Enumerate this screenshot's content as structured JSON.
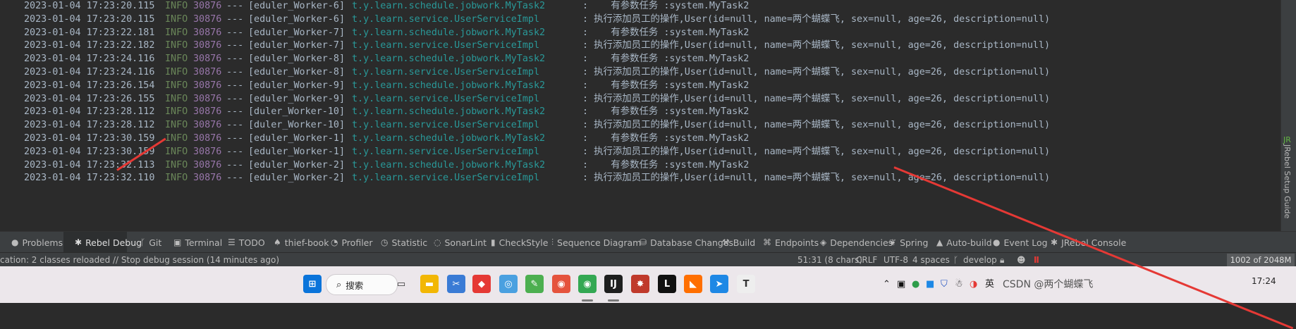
{
  "console": {
    "rows": [
      {
        "ts": "2023-01-04 17:23:20.115",
        "level": "INFO",
        "pid": "30876",
        "sep": "---",
        "thread": "[eduler_Worker-6]",
        "cls": "t.y.learn.schedule.jobwork.MyTask2",
        "msg": ":    有参数任务 :system.MyTask2"
      },
      {
        "ts": "2023-01-04 17:23:20.115",
        "level": "INFO",
        "pid": "30876",
        "sep": "---",
        "thread": "[eduler_Worker-6]",
        "cls": "t.y.learn.service.UserServiceImpl",
        "msg": ": 执行添加员工的操作,User(id=null, name=两个蝴蝶飞, sex=null, age=26, description=null)"
      },
      {
        "ts": "2023-01-04 17:23:22.181",
        "level": "INFO",
        "pid": "30876",
        "sep": "---",
        "thread": "[eduler_Worker-7]",
        "cls": "t.y.learn.schedule.jobwork.MyTask2",
        "msg": ":    有参数任务 :system.MyTask2"
      },
      {
        "ts": "2023-01-04 17:23:22.182",
        "level": "INFO",
        "pid": "30876",
        "sep": "---",
        "thread": "[eduler_Worker-7]",
        "cls": "t.y.learn.service.UserServiceImpl",
        "msg": ": 执行添加员工的操作,User(id=null, name=两个蝴蝶飞, sex=null, age=26, description=null)"
      },
      {
        "ts": "2023-01-04 17:23:24.116",
        "level": "INFO",
        "pid": "30876",
        "sep": "---",
        "thread": "[eduler_Worker-8]",
        "cls": "t.y.learn.schedule.jobwork.MyTask2",
        "msg": ":    有参数任务 :system.MyTask2"
      },
      {
        "ts": "2023-01-04 17:23:24.116",
        "level": "INFO",
        "pid": "30876",
        "sep": "---",
        "thread": "[eduler_Worker-8]",
        "cls": "t.y.learn.service.UserServiceImpl",
        "msg": ": 执行添加员工的操作,User(id=null, name=两个蝴蝶飞, sex=null, age=26, description=null)"
      },
      {
        "ts": "2023-01-04 17:23:26.154",
        "level": "INFO",
        "pid": "30876",
        "sep": "---",
        "thread": "[eduler_Worker-9]",
        "cls": "t.y.learn.schedule.jobwork.MyTask2",
        "msg": ":    有参数任务 :system.MyTask2"
      },
      {
        "ts": "2023-01-04 17:23:26.155",
        "level": "INFO",
        "pid": "30876",
        "sep": "---",
        "thread": "[eduler_Worker-9]",
        "cls": "t.y.learn.service.UserServiceImpl",
        "msg": ": 执行添加员工的操作,User(id=null, name=两个蝴蝶飞, sex=null, age=26, description=null)"
      },
      {
        "ts": "2023-01-04 17:23:28.112",
        "level": "INFO",
        "pid": "30876",
        "sep": "---",
        "thread": "[duler_Worker-10]",
        "cls": "t.y.learn.schedule.jobwork.MyTask2",
        "msg": ":    有参数任务 :system.MyTask2"
      },
      {
        "ts": "2023-01-04 17:23:28.112",
        "level": "INFO",
        "pid": "30876",
        "sep": "---",
        "thread": "[duler_Worker-10]",
        "cls": "t.y.learn.service.UserServiceImpl",
        "msg": ": 执行添加员工的操作,User(id=null, name=两个蝴蝶飞, sex=null, age=26, description=null)"
      },
      {
        "ts": "2023-01-04 17:23:30.159",
        "level": "INFO",
        "pid": "30876",
        "sep": "---",
        "thread": "[eduler_Worker-1]",
        "cls": "t.y.learn.schedule.jobwork.MyTask2",
        "msg": ":    有参数任务 :system.MyTask2"
      },
      {
        "ts": "2023-01-04 17:23:30.159",
        "level": "INFO",
        "pid": "30876",
        "sep": "---",
        "thread": "[eduler_Worker-1]",
        "cls": "t.y.learn.service.UserServiceImpl",
        "msg": ": 执行添加员工的操作,User(id=null, name=两个蝴蝶飞, sex=null, age=26, description=null)"
      },
      {
        "ts": "2023-01-04 17:23:32.113",
        "level": "INFO",
        "pid": "30876",
        "sep": "---",
        "thread": "[eduler_Worker-2]",
        "cls": "t.y.learn.schedule.jobwork.MyTask2",
        "msg": ":    有参数任务 :system.MyTask2"
      },
      {
        "ts": "2023-01-04 17:23:32.110",
        "level": "INFO",
        "pid": "30876",
        "sep": "---",
        "thread": "[eduler_Worker-2]",
        "cls": "t.y.learn.service.UserServiceImpl",
        "msg": ": 执行添加员工的操作,User(id=null, name=两个蝴蝶飞, sex=null, age=26, description=null)"
      }
    ]
  },
  "right_panel": {
    "label": "JRebel Setup Guide",
    "badge": "JR"
  },
  "toolbar": {
    "tabs": [
      {
        "label": "Problems",
        "icon": "problems-icon",
        "glyph": "●"
      },
      {
        "label": "Rebel Debug",
        "icon": "rebel-debug-icon",
        "glyph": "✱"
      },
      {
        "label": "Git",
        "icon": "git-icon",
        "glyph": "ᚴ"
      },
      {
        "label": "Terminal",
        "icon": "terminal-icon",
        "glyph": "▣"
      },
      {
        "label": "TODO",
        "icon": "todo-icon",
        "glyph": "☰"
      },
      {
        "label": "thief-book",
        "icon": "thief-book-icon",
        "glyph": "♠"
      },
      {
        "label": "Profiler",
        "icon": "profiler-icon",
        "glyph": "◔"
      },
      {
        "label": "Statistic",
        "icon": "statistic-icon",
        "glyph": "◷"
      },
      {
        "label": "SonarLint",
        "icon": "sonarlint-icon",
        "glyph": "◌"
      },
      {
        "label": "CheckStyle",
        "icon": "checkstyle-icon",
        "glyph": "▮"
      },
      {
        "label": "Sequence Diagram",
        "icon": "sequence-diagram-icon",
        "glyph": "⫶"
      },
      {
        "label": "Database Changes",
        "icon": "database-icon",
        "glyph": "⛁"
      },
      {
        "label": "Build",
        "icon": "build-icon",
        "glyph": "⚒"
      },
      {
        "label": "Endpoints",
        "icon": "endpoints-icon",
        "glyph": "⌘"
      },
      {
        "label": "Dependencies",
        "icon": "dependencies-icon",
        "glyph": "◈"
      },
      {
        "label": "Spring",
        "icon": "spring-icon",
        "glyph": "❦"
      },
      {
        "label": "Auto-build",
        "icon": "auto-build-icon",
        "glyph": "▲"
      },
      {
        "label": "Event Log",
        "icon": "event-log-icon",
        "glyph": "●"
      },
      {
        "label": "JRebel Console",
        "icon": "jrebel-console-icon",
        "glyph": "✱"
      }
    ],
    "active": "Rebel Debug"
  },
  "status": {
    "message": "cation: 2 classes reloaded // Stop debug session (14 minutes ago)",
    "position": "51:31 (8 chars)",
    "line_sep": "CRLF",
    "encoding": "UTF-8",
    "indent": "4 spaces",
    "branch": "develop",
    "memory": "1002 of 2048M"
  },
  "taskbar": {
    "search_label": "搜索",
    "apps": [
      {
        "name": "start-icon",
        "glyph": "⊞",
        "color": "#0a74da"
      },
      {
        "name": "task-view-icon",
        "glyph": "▭",
        "color": "#333333"
      },
      {
        "name": "file-explorer-icon",
        "glyph": "▬",
        "color": "#f2b705"
      },
      {
        "name": "snipping-icon",
        "glyph": "✂",
        "color": "#3a7bd5"
      },
      {
        "name": "app-red-icon",
        "glyph": "◆",
        "color": "#e53935"
      },
      {
        "name": "app-circles-icon",
        "glyph": "◎",
        "color": "#4aa0e0"
      },
      {
        "name": "notepad-icon",
        "glyph": "✎",
        "color": "#4caf50"
      },
      {
        "name": "app-spiral-icon",
        "glyph": "◉",
        "color": "#e5533d"
      },
      {
        "name": "chrome-icon",
        "glyph": "◉",
        "color": "#34a853"
      },
      {
        "name": "intellij-icon",
        "glyph": "IJ",
        "color": "#1e1e1e"
      },
      {
        "name": "app-star-icon",
        "glyph": "✸",
        "color": "#c0392b"
      },
      {
        "name": "app-l-icon",
        "glyph": "L",
        "color": "#111111"
      },
      {
        "name": "app-orange-icon",
        "glyph": "◣",
        "color": "#ff6f00"
      },
      {
        "name": "app-blue-icon",
        "glyph": "➤",
        "color": "#1e88e5"
      },
      {
        "name": "typora-icon",
        "glyph": "T",
        "color": "#eeeeee"
      }
    ],
    "tray_text": "英",
    "watermark": "CSDN @两个蝴蝶飞",
    "clock": "17:24"
  }
}
